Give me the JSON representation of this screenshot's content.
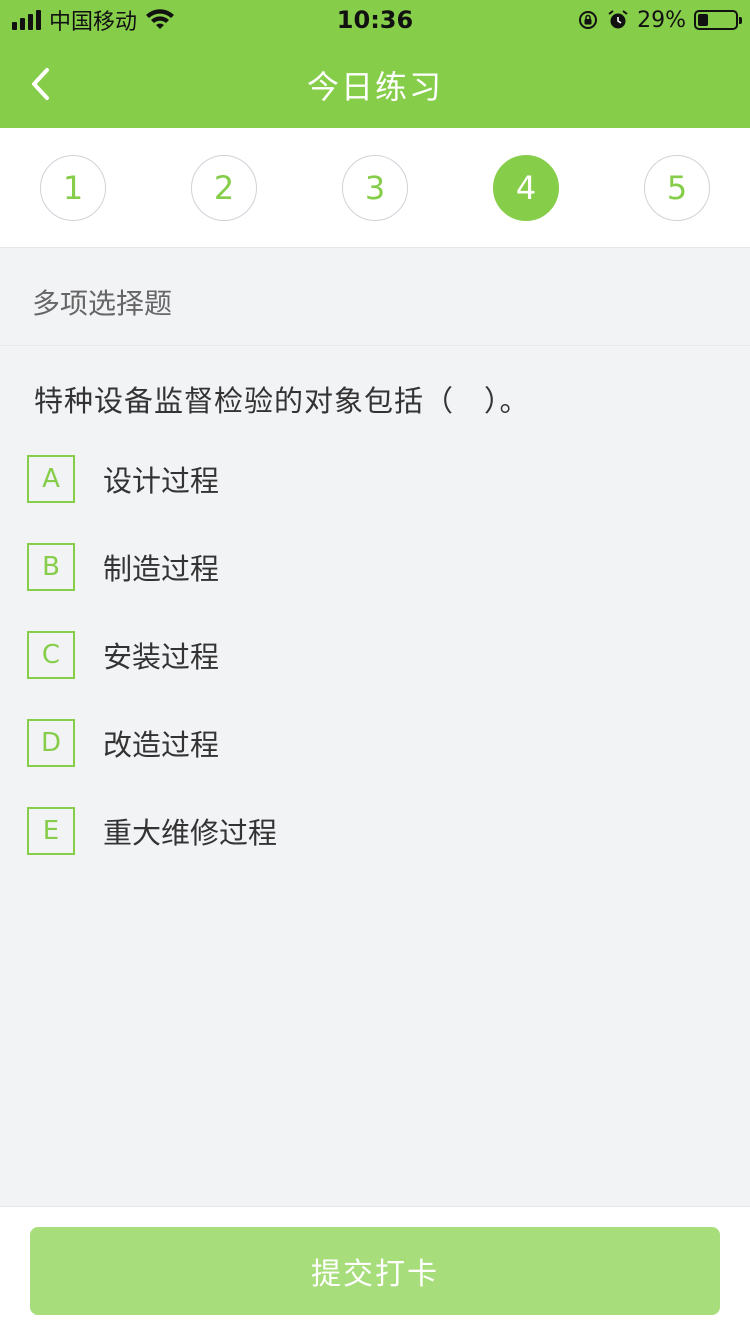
{
  "status_bar": {
    "carrier": "中国移动",
    "time": "10:36",
    "battery_percent": "29%",
    "battery_level": 0.29,
    "icons": [
      "signal-icon",
      "wifi-icon",
      "orientation-lock-icon",
      "alarm-icon",
      "battery-icon"
    ]
  },
  "header": {
    "title": "今日练习",
    "back_icon": "chevron-left-icon"
  },
  "question_numbers": {
    "items": [
      "1",
      "2",
      "3",
      "4",
      "5"
    ],
    "active": "4"
  },
  "section": {
    "title": "多项选择题"
  },
  "question": {
    "text": "特种设备监督检验的对象包括（　）。",
    "options": [
      {
        "letter": "A",
        "text": "设计过程"
      },
      {
        "letter": "B",
        "text": "制造过程"
      },
      {
        "letter": "C",
        "text": "安装过程"
      },
      {
        "letter": "D",
        "text": "改造过程"
      },
      {
        "letter": "E",
        "text": "重大维修过程"
      }
    ]
  },
  "footer": {
    "submit_label": "提交打卡"
  },
  "colors": {
    "accent": "#86cd4a",
    "accent_light": "#a8dd7c",
    "background": "#f2f3f5",
    "text": "#333333"
  }
}
